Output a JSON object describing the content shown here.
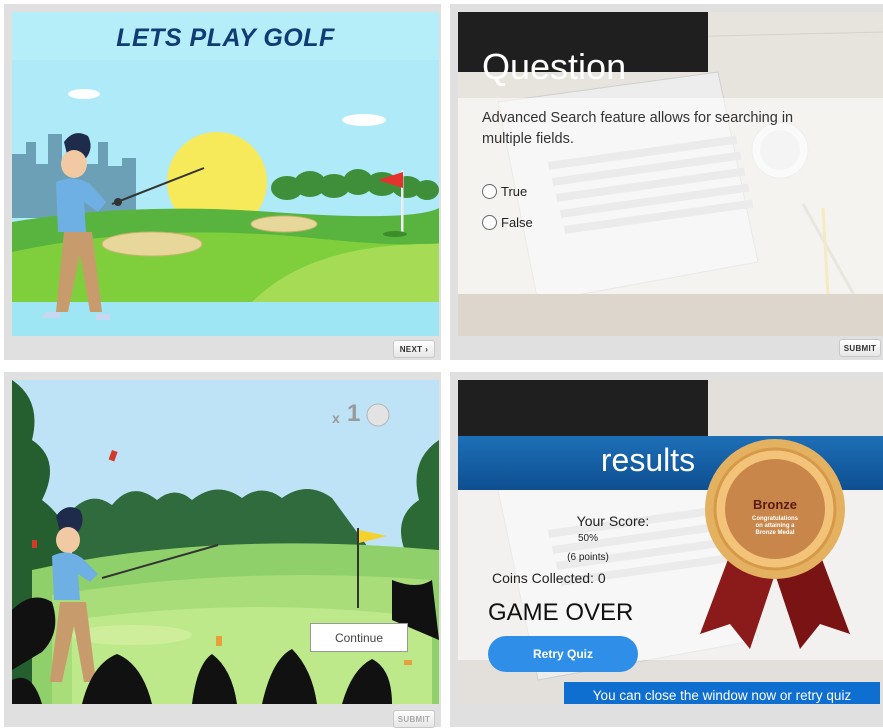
{
  "panel1": {
    "title": "LETS PLAY GOLF",
    "next_label": "NEXT",
    "next_icon": "chevron-right-icon"
  },
  "panel2": {
    "heading": "Question",
    "question": "Advanced Search  feature allows for searching in multiple fields.",
    "options": [
      {
        "label": "True"
      },
      {
        "label": "False"
      }
    ],
    "submit_label": "SUBMIT"
  },
  "panel3": {
    "multiplier": "x",
    "count": "1",
    "continue_label": "Continue",
    "submit_label": "SUBMIT"
  },
  "panel4": {
    "heading": "results",
    "score_label": "Your Score:",
    "score_percent": "50%",
    "score_points": "(6 points)",
    "coins_label": "Coins Collected:  0",
    "game_over": "GAME OVER",
    "retry_label": "Retry Quiz",
    "close_message": "You can close the window now or retry quiz",
    "medal": {
      "title": "Bronze",
      "subtitle_lines": [
        "Congratulations",
        "on attaining a",
        "Bronze Medal"
      ]
    }
  },
  "colors": {
    "title_navy": "#0f3c73",
    "results_blue": "#1d6fb7",
    "retry_blue": "#2f8fe8",
    "medal_bronze": "#c9864b",
    "ribbon_red": "#8b1a1a"
  }
}
